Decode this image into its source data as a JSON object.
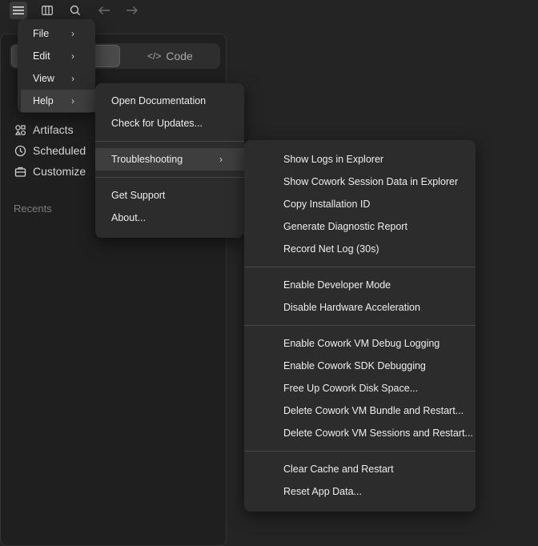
{
  "sidebar": {
    "segmented": {
      "code_label": "Code"
    },
    "nav": [
      {
        "label": "Artifacts",
        "icon": "artifacts-icon"
      },
      {
        "label": "Scheduled",
        "icon": "clock-icon"
      },
      {
        "label": "Customize",
        "icon": "briefcase-icon"
      }
    ],
    "recents_label": "Recents"
  },
  "main_menu": {
    "items": [
      {
        "label": "File"
      },
      {
        "label": "Edit"
      },
      {
        "label": "View"
      },
      {
        "label": "Help"
      }
    ]
  },
  "help_menu": {
    "items": [
      "Open Documentation",
      "Check for Updates...",
      "Troubleshooting",
      "Get Support",
      "About..."
    ]
  },
  "troubleshooting_menu": {
    "groups": [
      [
        "Show Logs in Explorer",
        "Show Cowork Session Data in Explorer",
        "Copy Installation ID",
        "Generate Diagnostic Report",
        "Record Net Log (30s)"
      ],
      [
        "Enable Developer Mode",
        "Disable Hardware Acceleration"
      ],
      [
        "Enable Cowork VM Debug Logging",
        "Enable Cowork SDK Debugging",
        "Free Up Cowork Disk Space...",
        "Delete Cowork VM Bundle and Restart...",
        "Delete Cowork VM Sessions and Restart..."
      ],
      [
        "Clear Cache and Restart",
        "Reset App Data..."
      ]
    ]
  },
  "colors": {
    "background": "#242424",
    "menu_bg": "#2c2c2c",
    "highlight": "#3e3e3e"
  }
}
